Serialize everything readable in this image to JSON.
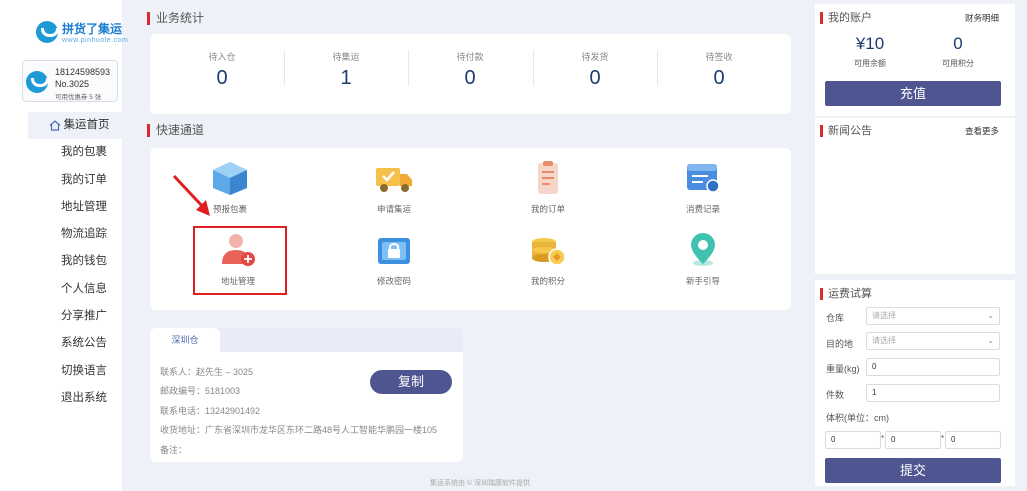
{
  "logo": {
    "title": "拼货了集运",
    "subtitle": "www.pinhuole.com"
  },
  "user": {
    "phone": "18124598593",
    "number": "No.3025",
    "coupon": "可用优惠券 5 张"
  },
  "sidebar": {
    "active": "集运首页",
    "items": [
      "我的包裹",
      "我的订单",
      "地址管理",
      "物流追踪",
      "我的钱包",
      "个人信息",
      "分享推广",
      "系统公告",
      "切换语言",
      "退出系统"
    ]
  },
  "stats": {
    "title": "业务统计",
    "items": [
      {
        "label": "待入仓",
        "value": "0"
      },
      {
        "label": "待集运",
        "value": "1"
      },
      {
        "label": "待付款",
        "value": "0"
      },
      {
        "label": "待发货",
        "value": "0"
      },
      {
        "label": "待签收",
        "value": "0"
      }
    ]
  },
  "quick": {
    "title": "快速通道",
    "items": [
      {
        "label": "预报包裹",
        "icon": "package-icon"
      },
      {
        "label": "申请集运",
        "icon": "truck-icon"
      },
      {
        "label": "我的订单",
        "icon": "clipboard-icon"
      },
      {
        "label": "消费记录",
        "icon": "record-icon"
      },
      {
        "label": "地址管理",
        "icon": "address-icon"
      },
      {
        "label": "修改密码",
        "icon": "lock-icon"
      },
      {
        "label": "我的积分",
        "icon": "coins-icon"
      },
      {
        "label": "新手引导",
        "icon": "guide-icon"
      }
    ]
  },
  "warehouse": {
    "tab": "深圳仓",
    "contact": "联系人：赵先生 – 3025",
    "postal": "邮政编号：5181003",
    "phone": "联系电话：13242901492",
    "address": "收货地址：广东省深圳市龙华区东环二路48号人工智能华鹏园一楼105",
    "note": "备注：",
    "copy_label": "复制"
  },
  "account": {
    "title": "我的账户",
    "finance_link": "财务明细",
    "balance": "¥10",
    "balance_label": "可用余额",
    "points": "0",
    "points_label": "可用积分",
    "recharge": "充值"
  },
  "news": {
    "title": "新闻公告",
    "more": "查看更多"
  },
  "calc": {
    "title": "运费试算",
    "warehouse_label": "仓库",
    "warehouse_placeholder": "请选择",
    "dest_label": "目的地",
    "dest_placeholder": "请选择",
    "weight_label": "重量(kg)",
    "weight_value": "0",
    "count_label": "件数",
    "count_value": "1",
    "volume_label": "体积(单位：cm)",
    "dims": [
      "0",
      "0",
      "0"
    ],
    "times": "*",
    "submit": "提交"
  },
  "footer": "集运系统由 © 深圳瑞康软件提供",
  "colors": {
    "accent": "#4e5590",
    "title_bar": "#d92b2b",
    "highlight": "#e02020"
  }
}
